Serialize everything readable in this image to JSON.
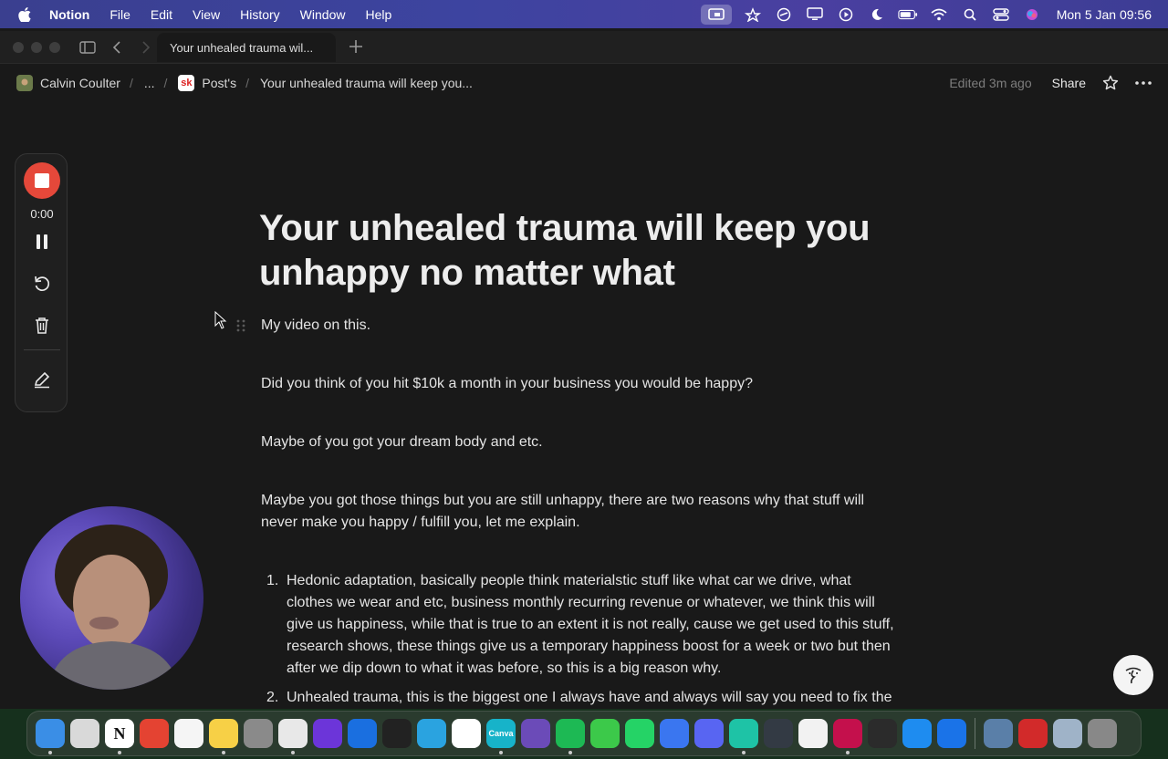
{
  "menubar": {
    "app_name": "Notion",
    "menus": [
      "File",
      "Edit",
      "View",
      "History",
      "Window",
      "Help"
    ],
    "clock": "Mon 5 Jan  09:56",
    "status_icons": [
      "screen-record-icon",
      "cloud-icon",
      "clock-icon",
      "display-icon",
      "play-icon",
      "moon-icon",
      "battery-icon",
      "wifi-icon",
      "search-icon",
      "control-center-icon",
      "siri-icon"
    ]
  },
  "tabbar": {
    "tab_title": "Your unhealed trauma wil..."
  },
  "topbar": {
    "workspace": "Calvin Coulter",
    "ellipsis": "...",
    "parent_icon": "sk",
    "parent": "Post's",
    "current": "Your unhealed trauma will keep you...",
    "edited": "Edited 3m ago",
    "share": "Share"
  },
  "recorder": {
    "time": "0:00"
  },
  "page": {
    "title": "Your unhealed trauma will keep you unhappy no matter what",
    "paragraphs": [
      "My video on this.",
      "Did you think of you hit $10k a month in your business you would be happy?",
      "Maybe of you got your dream body and etc.",
      "Maybe you got those things but you are still unhappy, there are two reasons why that stuff will never make you happy / fulfill you, let me explain."
    ],
    "list": [
      {
        "num": "1.",
        "text": "Hedonic adaptation, basically people think materialstic stuff like what car we drive, what clothes we wear and etc, business monthly recurring revenue or whatever, we think this will give us happiness, while that is true to an extent it is not really, cause we get used to this stuff, research shows, these things give us a temporary happiness boost for a week or two but then after we dip down to what it was before, so this is a big reason why."
      },
      {
        "num": "2.",
        "text": "Unhealed trauma, this is the biggest one I always have and always will say you need to fix the"
      }
    ]
  },
  "dock": {
    "apps": [
      {
        "name": "finder",
        "color": "#3a8ee6",
        "running": true
      },
      {
        "name": "launchpad",
        "color": "#d9d9d9",
        "running": false
      },
      {
        "name": "notion",
        "color": "#ffffff",
        "label": "N",
        "running": true
      },
      {
        "name": "todoist",
        "color": "#e44332",
        "running": false
      },
      {
        "name": "reminders",
        "color": "#f5f5f5",
        "running": false
      },
      {
        "name": "notes",
        "color": "#f7d046",
        "running": true
      },
      {
        "name": "system-settings",
        "color": "#8a8a8a",
        "running": false
      },
      {
        "name": "chrome",
        "color": "#e8e8e8",
        "running": true
      },
      {
        "name": "arc",
        "color": "#6c35d9",
        "running": false
      },
      {
        "name": "screen-studio",
        "color": "#1a6fe0",
        "running": false
      },
      {
        "name": "voice-memos",
        "color": "#222222",
        "running": false
      },
      {
        "name": "telegram",
        "color": "#2aa3e0",
        "running": false
      },
      {
        "name": "capcut",
        "color": "#ffffff",
        "running": false
      },
      {
        "name": "canva",
        "color": "#17b3c9",
        "label": "Canva",
        "running": true
      },
      {
        "name": "proton-vpn",
        "color": "#6b4bb8",
        "running": false
      },
      {
        "name": "spotify",
        "color": "#1db954",
        "running": true
      },
      {
        "name": "messages",
        "color": "#3cc94a",
        "running": false
      },
      {
        "name": "whatsapp",
        "color": "#25d366",
        "running": false
      },
      {
        "name": "signal",
        "color": "#3a76f0",
        "running": false
      },
      {
        "name": "discord",
        "color": "#5865f2",
        "running": false
      },
      {
        "name": "surfshark",
        "color": "#1ec3a6",
        "running": true
      },
      {
        "name": "cloud-app",
        "color": "#333a44",
        "running": false
      },
      {
        "name": "photos",
        "color": "#f2f2f2",
        "running": false
      },
      {
        "name": "youtube-app",
        "color": "#c4104c",
        "running": true
      },
      {
        "name": "quill-app",
        "color": "#2b2b2b",
        "running": false
      },
      {
        "name": "app-store",
        "color": "#1e8cf0",
        "running": false
      },
      {
        "name": "relay-app",
        "color": "#1a73e8",
        "running": false
      }
    ],
    "recent": [
      {
        "name": "preview",
        "color": "#5a7fa8"
      },
      {
        "name": "pdf-app",
        "color": "#d22a2a"
      },
      {
        "name": "quicktime",
        "color": "#9fb3c8"
      }
    ],
    "trash": {
      "name": "trash",
      "color": "#888888"
    }
  }
}
